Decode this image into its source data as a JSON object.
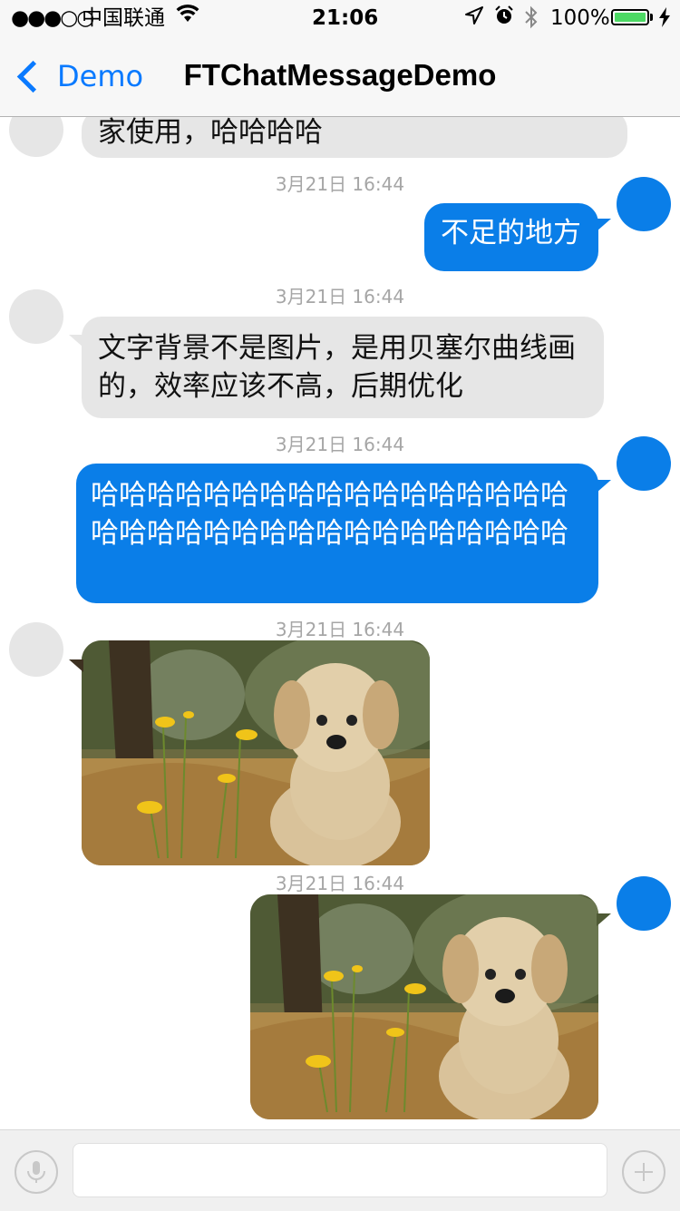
{
  "status_bar": {
    "signal": "●●●○○",
    "carrier": "中国联通",
    "time": "21:06",
    "battery": "100%"
  },
  "nav": {
    "back_label": "Demo",
    "title": "FTChatMessageDemo"
  },
  "colors": {
    "accent": "#0a7aff",
    "outgoing_bubble": "#0a7ee8",
    "incoming_bubble": "#e6e6e6"
  },
  "messages": [
    {
      "direction": "incoming",
      "type": "text",
      "text": "家使用，哈哈哈哈"
    },
    {
      "timestamp": "3月21日 16:44",
      "direction": "outgoing",
      "type": "text",
      "text": "不足的地方"
    },
    {
      "timestamp": "3月21日 16:44",
      "direction": "incoming",
      "type": "text",
      "text": "文字背景不是图片，是用贝塞尔曲线画的，效率应该不高，后期优化"
    },
    {
      "timestamp": "3月21日 16:44",
      "direction": "outgoing",
      "type": "text",
      "text": "哈哈哈哈哈哈哈哈哈哈哈哈哈哈哈哈哈哈哈哈哈哈哈哈哈哈哈哈哈哈哈哈哈哈"
    },
    {
      "timestamp": "3月21日 16:44",
      "direction": "incoming",
      "type": "image",
      "image": "puppy-photo"
    },
    {
      "timestamp": "3月21日 16:44",
      "direction": "outgoing",
      "type": "image",
      "image": "puppy-photo"
    }
  ],
  "input_bar": {
    "voice_icon": "mic-icon",
    "add_icon": "plus-icon",
    "placeholder": ""
  }
}
